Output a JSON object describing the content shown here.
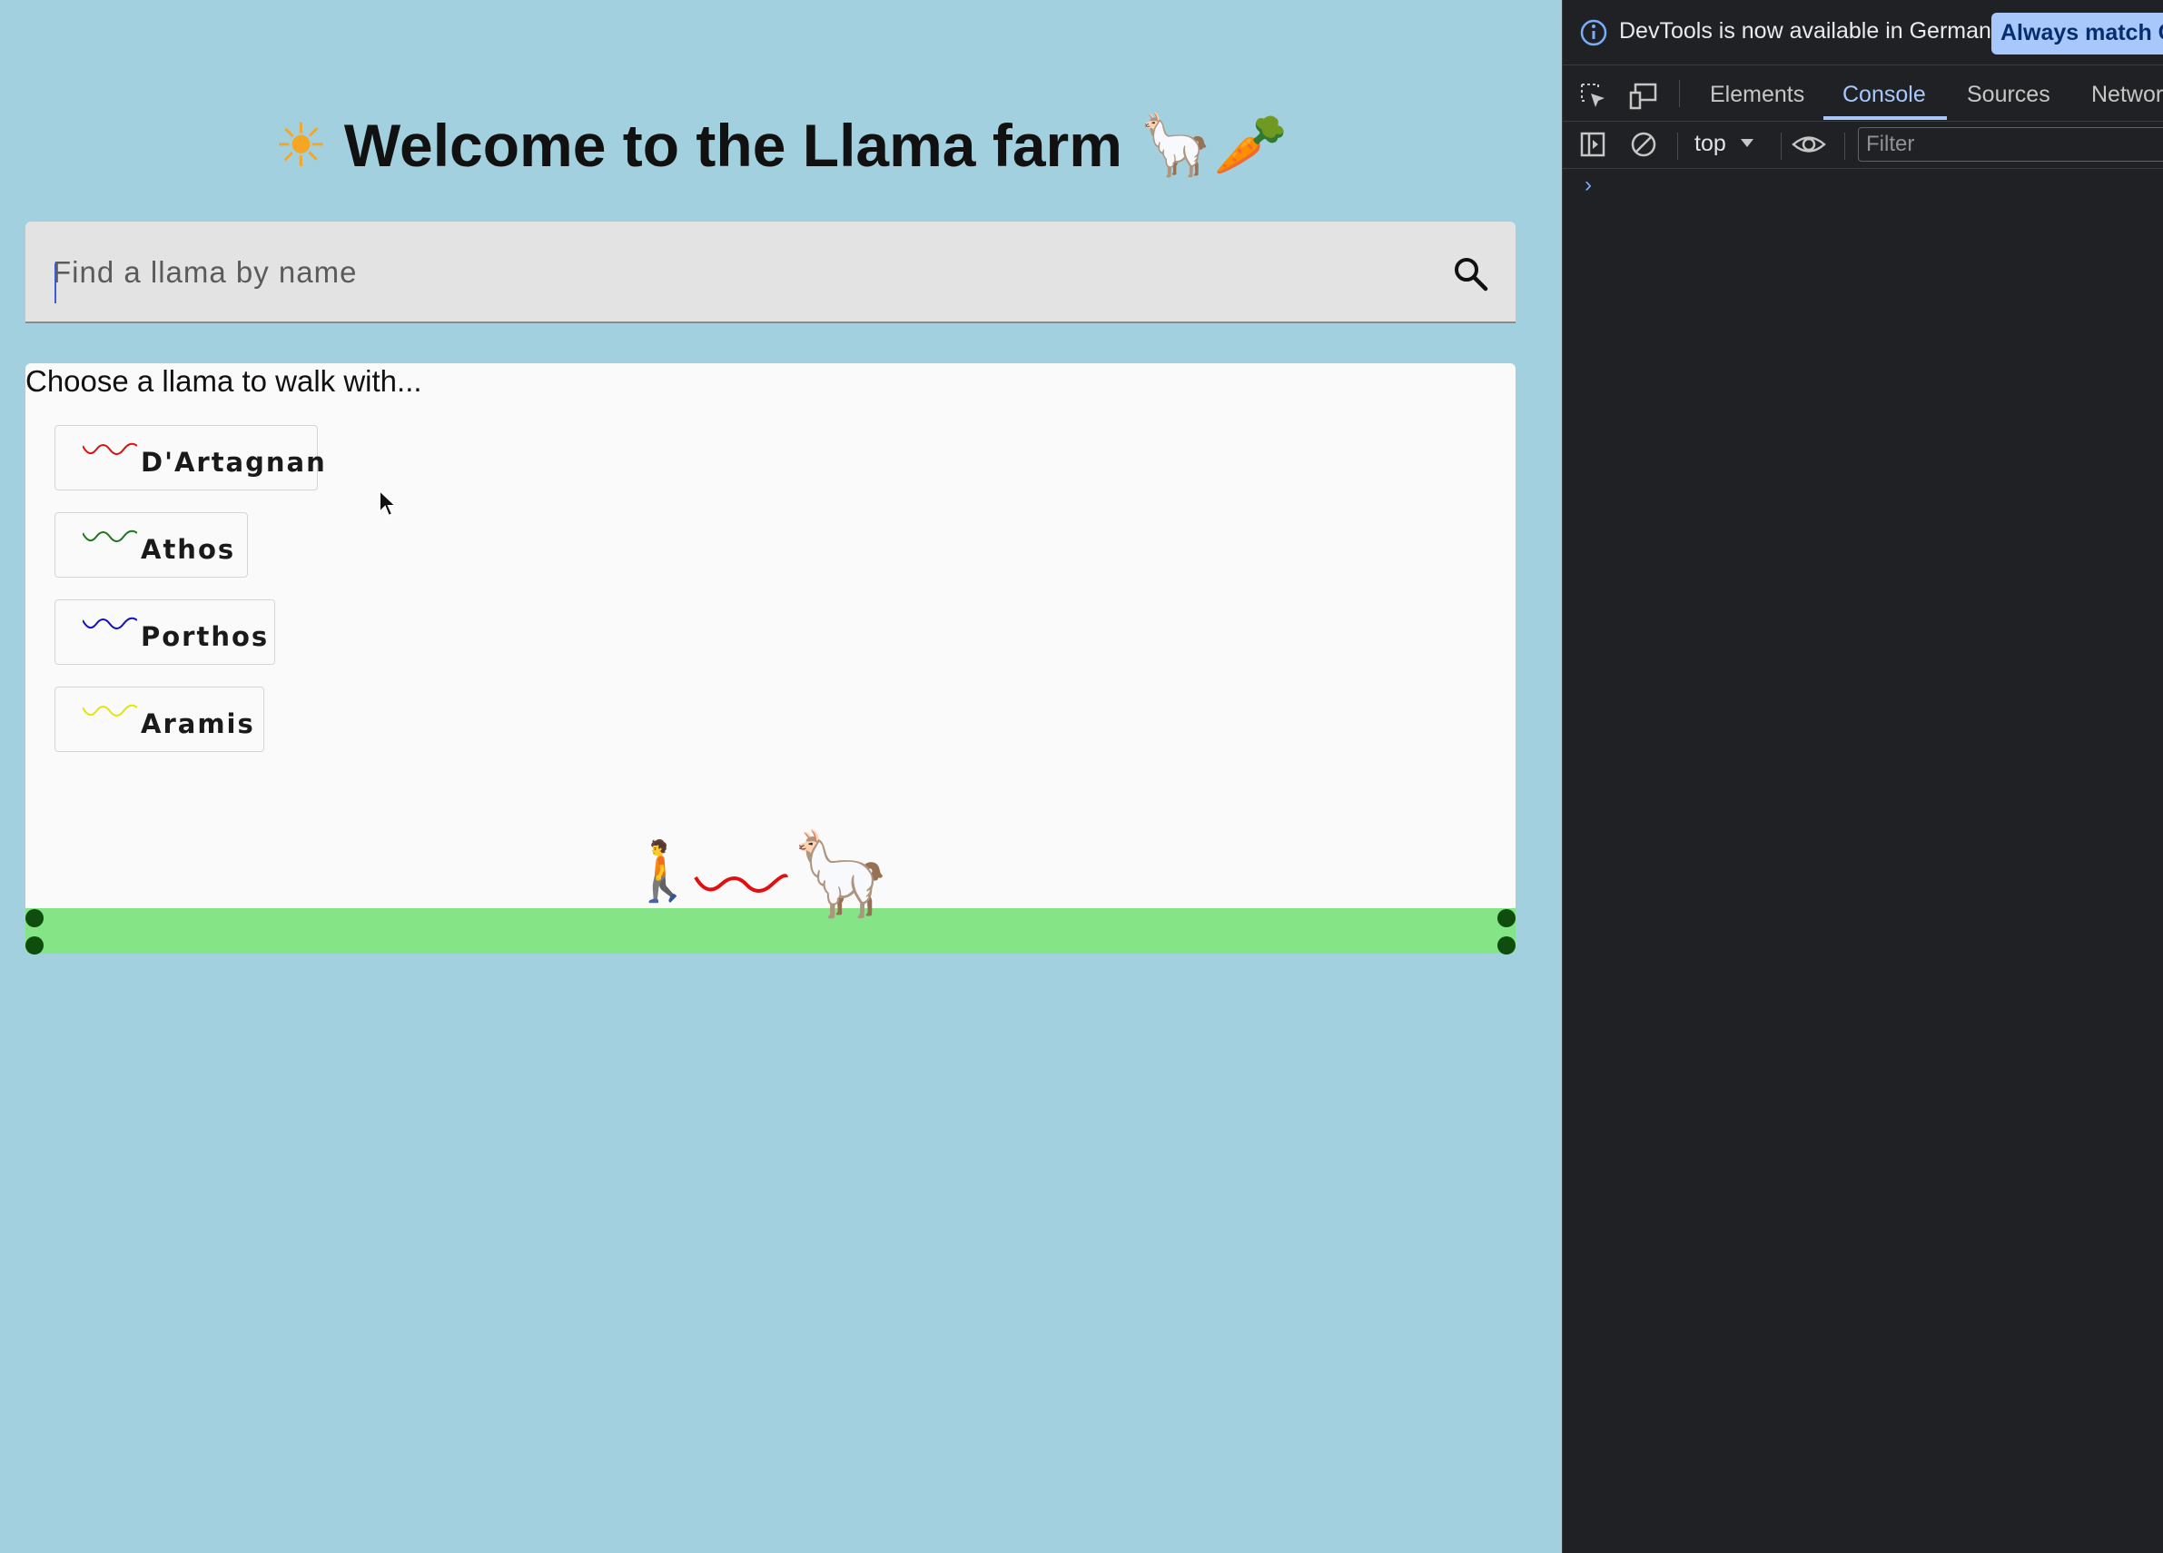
{
  "page": {
    "title": "Welcome to the Llama farm",
    "title_icons": {
      "left": "☀",
      "right": "🦙🥕"
    },
    "search": {
      "placeholder": "Find a llama by name",
      "value": ""
    },
    "choose_label": "Choose a llama to walk with...",
    "llamas": [
      {
        "name": "D'Artagnan",
        "leash_color": "#e01010"
      },
      {
        "name": "Athos",
        "leash_color": "#1a7a1a"
      },
      {
        "name": "Porthos",
        "leash_color": "#1010c8"
      },
      {
        "name": "Aramis",
        "leash_color": "#e6e600"
      }
    ],
    "walk_scene": {
      "walker_icon": "🚶",
      "llama_icon": "🦙",
      "leash_color": "#e01010",
      "ground_color": "#84e486"
    },
    "background_color": "#a2d0de"
  },
  "devtools": {
    "info_message": "DevTools is now available in German!",
    "info_button": "Always match Chrome's language",
    "tabs": [
      "Elements",
      "Console",
      "Sources",
      "Network"
    ],
    "active_tab": "Console",
    "context": "top",
    "filter_placeholder": "Filter",
    "console_prompt": "›"
  }
}
